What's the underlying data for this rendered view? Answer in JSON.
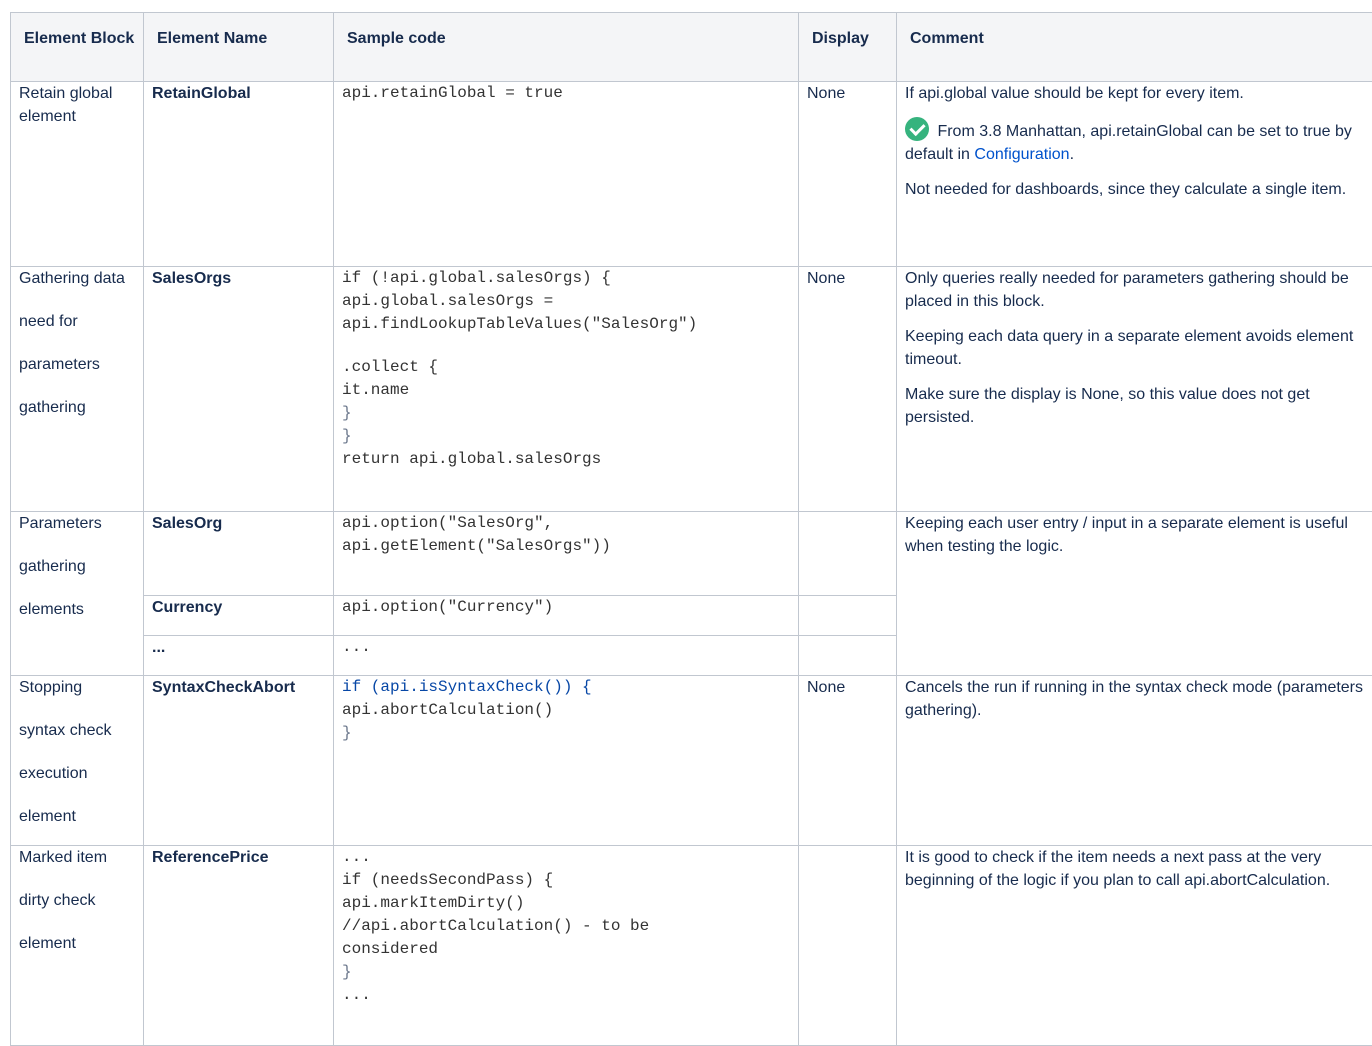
{
  "headers": {
    "block": "Element Block",
    "name": "Element Name",
    "code": "Sample code",
    "display": "Display",
    "comment": "Comment"
  },
  "rows": [
    {
      "block": [
        "Retain global element"
      ],
      "name": "RetainGlobal",
      "code": [
        "api.retainGlobal = true"
      ],
      "display": "None",
      "comment": {
        "p1": "If api.global value should be kept for every item.",
        "p2_icon": "check-circle-icon",
        "p2_text": " From 3.8 Manhattan, api.retainGlobal can be set to true by default in ",
        "p2_link": "Configuration",
        "p2_end": ".",
        "p3": "Not needed for dashboards, since they calculate a single item."
      }
    },
    {
      "block": [
        "Gathering data",
        "need for",
        "parameters",
        "gathering"
      ],
      "name": "SalesOrgs",
      "code": [
        "if (!api.global.salesOrgs) {",
        "api.global.salesOrgs =",
        "api.findLookupTableValues(\"SalesOrg\")",
        "",
        ".collect {",
        "it.name",
        "}",
        "}",
        "return api.global.salesOrgs"
      ],
      "display": "None",
      "comment": {
        "p1": "Only queries really needed for parameters gathering should be placed in this block.",
        "p2": "Keeping each data query in a separate element avoids element timeout.",
        "p3": "Make sure the display is None, so this value does not get persisted."
      }
    },
    {
      "block": [
        "Parameters",
        "gathering",
        "elements"
      ],
      "sub": [
        {
          "name": "SalesOrg",
          "code": [
            "api.option(\"SalesOrg\",",
            "api.getElement(\"SalesOrgs\"))"
          ],
          "display": ""
        },
        {
          "name": "Currency",
          "code": [
            "api.option(\"Currency\")"
          ],
          "display": ""
        },
        {
          "name": "...",
          "code": [
            "..."
          ],
          "display": ""
        }
      ],
      "comment": {
        "p1": "Keeping each user entry / input in a separate element is useful when testing the logic."
      }
    },
    {
      "block": [
        "Stopping",
        "syntax check",
        "execution",
        "element"
      ],
      "name": "SyntaxCheckAbort",
      "code": [
        "if (api.isSyntaxCheck()) {",
        "api.abortCalculation()",
        "}"
      ],
      "display": "None",
      "comment": {
        "p1": "Cancels the run if running in the syntax check mode (parameters gathering)."
      }
    },
    {
      "block": [
        "Marked item",
        "dirty check",
        "element"
      ],
      "name": "ReferencePrice",
      "code": [
        "...",
        "if (needsSecondPass) {",
        "api.markItemDirty()",
        "//api.abortCalculation() - to be",
        "considered",
        "}",
        "..."
      ],
      "display": "",
      "comment": {
        "p1": "It is good to check if the item needs a next pass at the very beginning of the logic if you plan to call api.abortCalculation."
      }
    }
  ]
}
